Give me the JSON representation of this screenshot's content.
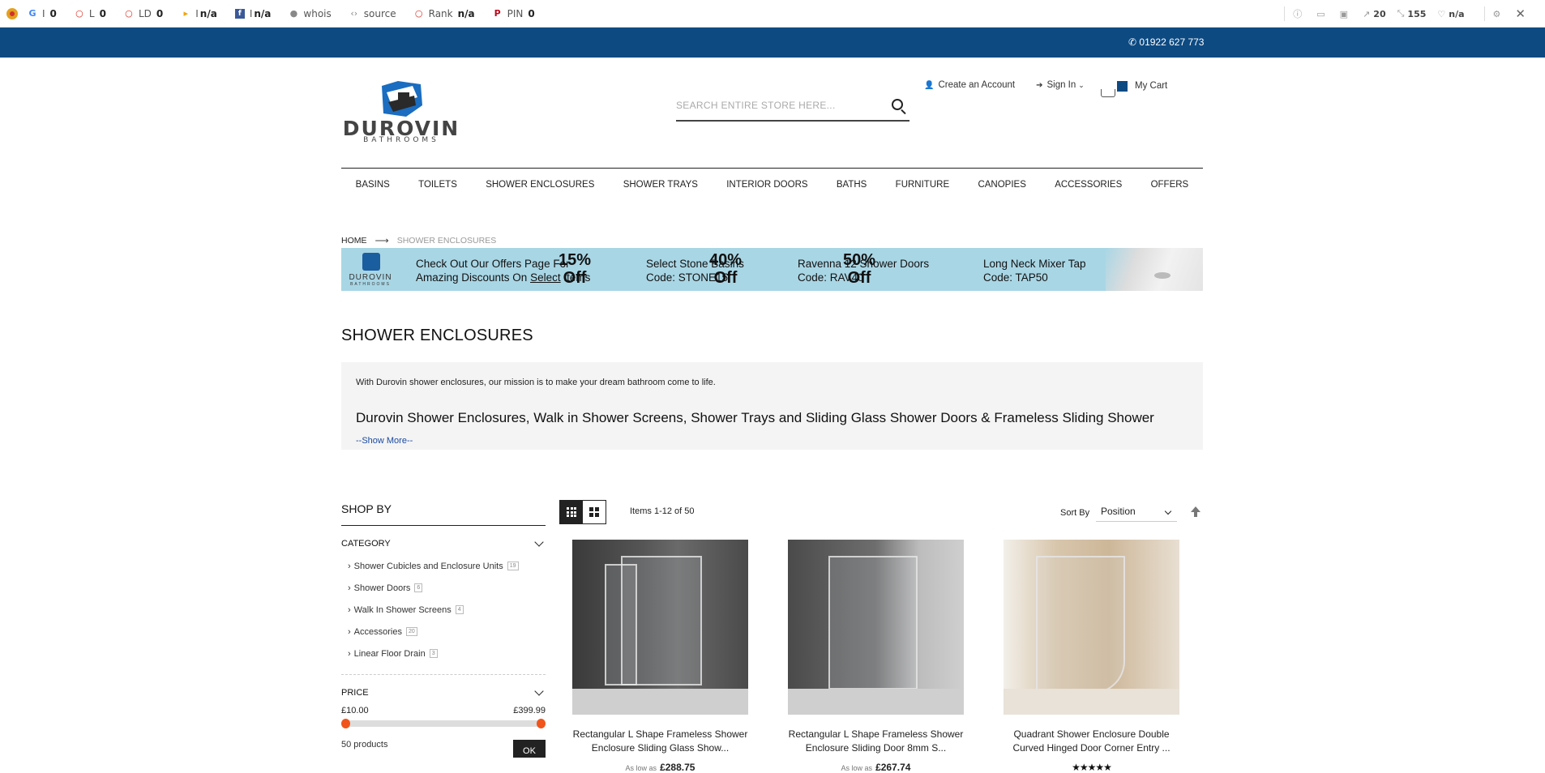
{
  "seo_bar": {
    "items": [
      {
        "label": "I",
        "value": "0",
        "icon": "google-icon",
        "color": "#4285f4"
      },
      {
        "label": "L",
        "value": "0",
        "icon": "circle-icon",
        "color": "#d93025"
      },
      {
        "label": "LD",
        "value": "0",
        "icon": "circle-icon",
        "color": "#d93025"
      },
      {
        "label": "I",
        "value": "n/a",
        "icon": "bing-icon",
        "color": "#f0a30a"
      },
      {
        "label": "I",
        "value": "n/a",
        "icon": "facebook-icon",
        "color": "#3b5998"
      },
      {
        "label": "whois",
        "value": "",
        "icon": "user-icon",
        "color": "#888"
      },
      {
        "label": "source",
        "value": "",
        "icon": "code-icon",
        "color": "#888"
      },
      {
        "label": "Rank",
        "value": "n/a",
        "icon": "circle-icon",
        "color": "#d93025"
      },
      {
        "label": "PIN",
        "value": "0",
        "icon": "pinterest-icon",
        "color": "#bd081c"
      }
    ],
    "right": {
      "links_out": "20",
      "links_in": "155",
      "alexa": "n/a"
    }
  },
  "top_bar": {
    "phone": "01922 627 773"
  },
  "logo": {
    "name": "DUROVIN",
    "tagline": "BATHROOMS"
  },
  "search": {
    "placeholder": "SEARCH ENTIRE STORE HERE..."
  },
  "header_links": {
    "create_account": "Create an Account",
    "sign_in": "Sign In",
    "cart": "My Cart"
  },
  "nav": [
    "BASINS",
    "TOILETS",
    "SHOWER ENCLOSURES",
    "SHOWER TRAYS",
    "INTERIOR DOORS",
    "BATHS",
    "FURNITURE",
    "CANOPIES",
    "ACCESSORIES",
    "OFFERS"
  ],
  "breadcrumb": {
    "home": "HOME",
    "current": "SHOWER ENCLOSURES"
  },
  "banner": {
    "line1": "Check Out Our Offers Page For",
    "line2a": "Amazing Discounts On ",
    "line2b": "Select",
    "line2c": " Items",
    "offers": [
      {
        "pct": "15%",
        "off": "Off",
        "title": "Select Stone Basins",
        "code": "Code: STONE15"
      },
      {
        "pct": "40%",
        "off": "Off",
        "title": "Ravenna 12 Shower Doors",
        "code": "Code: RAV40"
      },
      {
        "pct": "50%",
        "off": "Off",
        "title": "Long Neck Mixer Tap",
        "code": "Code: TAP50"
      }
    ]
  },
  "page_title": "SHOWER ENCLOSURES",
  "description": {
    "intro": "With Durovin shower enclosures, our mission is to make your dream bathroom come to life.",
    "heading": "Durovin Shower Enclosures, Walk in Shower Screens, Shower Trays and Sliding Glass Shower Doors & Frameless Sliding Shower",
    "show_more": "--Show More--"
  },
  "sidebar": {
    "title": "SHOP BY",
    "category_label": "CATEGORY",
    "categories": [
      {
        "name": "Shower Cubicles and Enclosure Units",
        "count": "19"
      },
      {
        "name": "Shower Doors",
        "count": "6"
      },
      {
        "name": "Walk In Shower Screens",
        "count": "4"
      },
      {
        "name": "Accessories",
        "count": "20"
      },
      {
        "name": "Linear Floor Drain",
        "count": "3"
      }
    ],
    "price_label": "PRICE",
    "price_min": "£10.00",
    "price_max": "£399.99",
    "product_count": "50 products",
    "ok": "OK"
  },
  "toolbar": {
    "items": "Items 1-12 of 50",
    "sort_by": "Sort By",
    "sort_value": "Position"
  },
  "products": [
    {
      "name1": "Rectangular L Shape Frameless Shower",
      "name2": "Enclosure Sliding Glass Show...",
      "as_low": "As low as",
      "price": "£288.75"
    },
    {
      "name1": "Rectangular L Shape Frameless Shower",
      "name2": "Enclosure Sliding Door 8mm S...",
      "as_low": "As low as",
      "price": "£267.74"
    },
    {
      "name1": "Quadrant Shower Enclosure Double",
      "name2": "Curved Hinged Door Corner Entry ...",
      "stars": "★★★★★"
    }
  ]
}
